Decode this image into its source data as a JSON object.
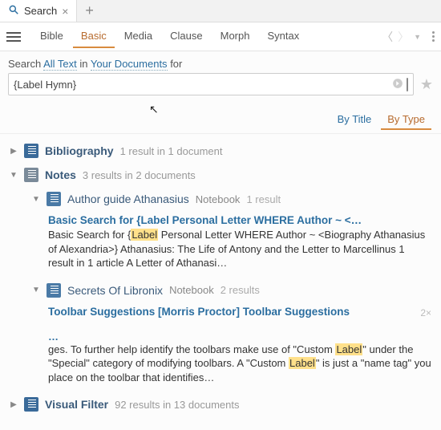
{
  "tab": {
    "title": "Search"
  },
  "modes": [
    "Bible",
    "Basic",
    "Media",
    "Clause",
    "Morph",
    "Syntax"
  ],
  "active_mode_index": 1,
  "search_prefix": "Search",
  "search_scope1": "All Text",
  "search_in": "in",
  "search_scope2": "Your Documents",
  "search_for": "for",
  "query": "{Label Hymn}",
  "result_tabs": [
    "By Title",
    "By Type"
  ],
  "active_result_tab_index": 1,
  "categories": [
    {
      "title": "Bibliography",
      "meta": "1 result in 1 document",
      "expanded": false,
      "icon": "doc"
    },
    {
      "title": "Notes",
      "meta": "3 results in 2 documents",
      "expanded": true,
      "icon": "note",
      "children": [
        {
          "title": "Author guide Athanasius",
          "kind": "Notebook",
          "meta": "1 result",
          "expanded": true,
          "items": [
            {
              "title": "Basic Search for {Label Personal Letter WHERE Author ~ <…",
              "body_pre": "Basic Search for {",
              "body_hl1": "Label",
              "body_mid": " Personal Letter WHERE Author ~ <Biography Athanasius of Alexandria>}    Athanasius: The Life of Antony and the Letter to Marcellinus 1 result in 1 article A Letter of Athanasi…"
            }
          ]
        },
        {
          "title": "Secrets Of Libronix",
          "kind": "Notebook",
          "meta": "2 results",
          "expanded": true,
          "items": [
            {
              "title": "Toolbar Suggestions [Morris Proctor] Toolbar Suggestions",
              "count": "2×",
              "elips": "…",
              "body_pre": "ges. To further help identify the toolbars make use of \"Custom ",
              "body_hl1": "Label",
              "body_mid": "\" under the \"Special\" category of modifying toolbars. A \"Custom ",
              "body_hl2": "Label",
              "body_post": "\" is just a \"name tag\" you place on the toolbar that identifies…"
            }
          ]
        }
      ]
    },
    {
      "title": "Visual Filter",
      "meta": "92 results in 13 documents",
      "expanded": false,
      "icon": "filter"
    }
  ]
}
